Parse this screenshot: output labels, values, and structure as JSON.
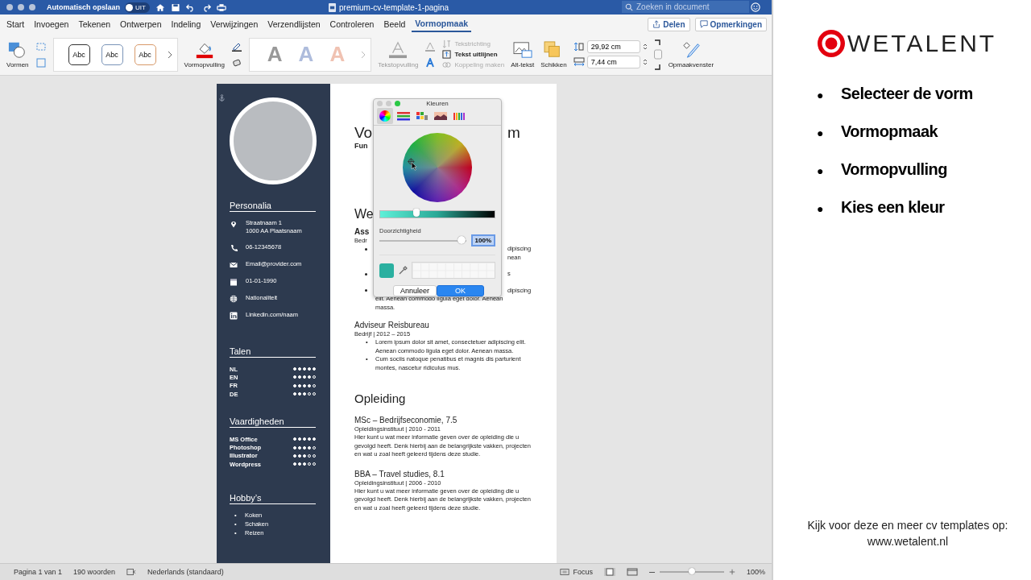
{
  "window": {
    "title": "premium-cv-template-1-pagina",
    "autosave_label": "Automatisch opslaan",
    "autosave_toggle": {
      "label": "UIT",
      "on": false
    },
    "search": {
      "placeholder": "Zoeken in document"
    }
  },
  "ribbon_tabs": [
    {
      "label": "Start",
      "selected": false
    },
    {
      "label": "Invoegen",
      "selected": false
    },
    {
      "label": "Tekenen",
      "selected": false
    },
    {
      "label": "Ontwerpen",
      "selected": false
    },
    {
      "label": "Indeling",
      "selected": false
    },
    {
      "label": "Verwijzingen",
      "selected": false
    },
    {
      "label": "Verzendlijsten",
      "selected": false
    },
    {
      "label": "Controleren",
      "selected": false
    },
    {
      "label": "Beeld",
      "selected": false
    },
    {
      "label": "Vormopmaak",
      "selected": true
    }
  ],
  "share_buttons": [
    {
      "kind": "share",
      "label": "Delen"
    },
    {
      "kind": "comments",
      "label": "Opmerkingen"
    }
  ],
  "ribbon": {
    "shapes_label": "Vormen",
    "style_presets": [
      "Abc",
      "Abc",
      "Abc"
    ],
    "shape_fill_label": "Vormopvulling",
    "wordart_styles": [
      "A",
      "A",
      "A"
    ],
    "text_fill_label": "Tekstopvulling",
    "text_options": [
      {
        "kind": "direction",
        "label": "Tekstrichting",
        "disabled": true
      },
      {
        "kind": "align",
        "label": "Tekst uitlijnen",
        "disabled": false
      },
      {
        "kind": "link",
        "label": "Koppeling maken",
        "disabled": true
      }
    ],
    "alt_text_label": "Alt-tekst",
    "arrange_label": "Schikken",
    "height_value": "29,92 cm",
    "width_value": "7,44 cm",
    "format_pane_label": "Opmaakvenster"
  },
  "sidebar": {
    "personalia_heading": "Personalia",
    "contacts": [
      {
        "kind": "location",
        "lines": [
          "Straatnaam 1",
          "1000 AA Plaatsnaam"
        ]
      },
      {
        "kind": "phone",
        "lines": [
          "06-12345678"
        ]
      },
      {
        "kind": "mail",
        "lines": [
          "Email@provider.com"
        ]
      },
      {
        "kind": "calendar",
        "lines": [
          "01-01-1990"
        ]
      },
      {
        "kind": "globe",
        "lines": [
          "Nationaliteit"
        ]
      },
      {
        "kind": "linkedin",
        "lines": [
          "Linkedin.com/naam"
        ]
      }
    ],
    "languages_heading": "Talen",
    "languages": [
      {
        "name": "NL",
        "stars": 5
      },
      {
        "name": "EN",
        "stars": 4
      },
      {
        "name": "FR",
        "stars": 4
      },
      {
        "name": "DE",
        "stars": 3
      }
    ],
    "skills_heading": "Vaardigheden",
    "skills": [
      {
        "name": "MS Office",
        "stars": 5
      },
      {
        "name": "Photoshop",
        "stars": 4
      },
      {
        "name": "Illustrator",
        "stars": 3
      },
      {
        "name": "Wordpress",
        "stars": 3
      }
    ],
    "hobbies_heading": "Hobby’s",
    "hobbies": [
      {
        "marker": "•",
        "text": "Koken"
      },
      {
        "marker": "•",
        "text": "Schaken"
      },
      {
        "marker": "•",
        "text": "Reizen"
      }
    ]
  },
  "main": {
    "name_heading": {
      "left": "Vo",
      "right": "m"
    },
    "function_line": "Fun",
    "section_heading": "We",
    "job_title": "Ass",
    "job_meta": "Bedr",
    "bullet_fragments": [
      {
        "bullet": true,
        "text": "dipiscing"
      },
      {
        "bullet": false,
        "text": "nean"
      },
      {
        "bullet": true,
        "text": "s"
      },
      {
        "bullet": true,
        "text": "dipiscing"
      }
    ],
    "bullet_tail": [
      "elit. Aenean commodo ligula eget dolor. Aenean",
      "massa."
    ],
    "jobs": [
      {
        "title": "Adviseur Reisbureau",
        "meta": "Bedrijf | 2012 – 2015",
        "bullets": [
          {
            "marker": "•",
            "text": "Lorem ipsum dolor sit amet, consectetuer adipiscing elit. Aenean commodo ligula eget dolor. Aenean massa."
          },
          {
            "marker": "•",
            "text": "Cum sociis natoque penatibus et magnis dis parturient montes, nascetur ridiculus mus."
          }
        ]
      }
    ],
    "education_heading": "Opleiding",
    "education": [
      {
        "title": "MSc – Bedrijfseconomie, 7.5",
        "meta": "Opleidingsinstituut | 2010 - 2011",
        "text": "Hier kunt u wat meer informatie geven over de opleiding die u gevolgd heeft. Denk hierbij aan de belangrijkste vakken, projecten en wat u zoal heeft geleerd tijdens deze studie."
      },
      {
        "title": "BBA – Travel studies, 8.1",
        "meta": "Opleidingsinstituut | 2006 - 2010",
        "text": "Hier kunt u wat meer informatie geven over de opleiding die u gevolgd heeft. Denk hierbij aan de belangrijkste vakken, projecten en wat u zoal heeft geleerd tijdens deze studie."
      }
    ]
  },
  "color_dialog": {
    "title": "Kleuren",
    "modes": [
      {
        "kind": "wheel",
        "selected": true
      },
      {
        "kind": "sliders",
        "selected": false
      },
      {
        "kind": "palettes",
        "selected": false
      },
      {
        "kind": "image",
        "selected": false
      },
      {
        "kind": "pencils",
        "selected": false
      }
    ],
    "brightness": {
      "level": 0.32
    },
    "opacity_label": "Doorzichtigheid",
    "opacity": {
      "level": 0.95
    },
    "opacity_value": "100%",
    "cancel_label": "Annuleer",
    "ok_label": "OK"
  },
  "status_bar": {
    "page": "Pagina 1 van 1",
    "words": "190 woorden",
    "language": "Nederlands (standaard)",
    "focus_label": "Focus",
    "zoom": {
      "level": 0.5
    },
    "zoom_value": "100%"
  },
  "promo": {
    "logo_text": "WETALENT",
    "steps": [
      {
        "marker": "●",
        "text": "Selecteer de vorm"
      },
      {
        "marker": "●",
        "text": "Vormopmaak"
      },
      {
        "marker": "●",
        "text": "Vormopvulling"
      },
      {
        "marker": "●",
        "text": "Kies een kleur"
      }
    ],
    "footer_lines": [
      "Kijk voor deze en meer cv templates op:",
      "www.wetalent.nl"
    ]
  }
}
